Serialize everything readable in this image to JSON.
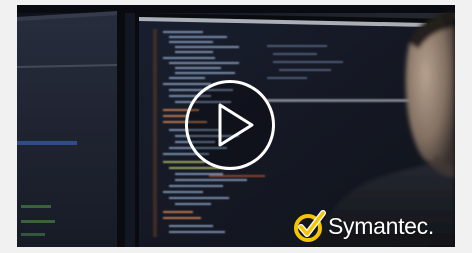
{
  "video": {
    "brand_name": "Symantec.",
    "brand_logo_icon": "symantec-check-logo",
    "play_icon": "play-icon",
    "colors": {
      "page_background": "#f1f1f1",
      "screen_dark": "#0e1118",
      "logo_gold": "#f7c500",
      "play_outline": "#ffffff"
    }
  }
}
